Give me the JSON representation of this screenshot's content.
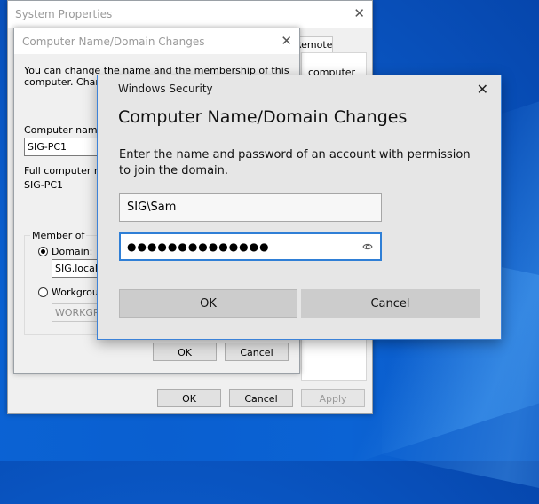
{
  "system_properties": {
    "title": "System Properties",
    "tab_remote": "Remote",
    "tab_text": "computer",
    "ok_label": "OK",
    "cancel_label": "Cancel",
    "apply_label": "Apply"
  },
  "name_dialog": {
    "title": "Computer Name/Domain Changes",
    "intro_line1": "You can change the name and the membership of this",
    "intro_line2": "computer. Changes might affect access to network resources.",
    "computer_name_label": "Computer name:",
    "computer_name_value": "SIG-PC1",
    "full_name_label": "Full computer name:",
    "full_name_value": "SIG-PC1",
    "member_of_label": "Member of",
    "domain_label": "Domain:",
    "domain_value": "SIG.local",
    "workgroup_label": "Workgroup:",
    "workgroup_value": "WORKGROUP",
    "ok_label": "OK",
    "cancel_label": "Cancel"
  },
  "windows_security": {
    "title": "Windows Security",
    "heading": "Computer Name/Domain Changes",
    "description": "Enter the name and password of an account with permission to join the domain.",
    "username_value": "SIG\\Sam",
    "password_masked": "●●●●●●●●●●●●●●",
    "ok_label": "OK",
    "cancel_label": "Cancel"
  },
  "colors": {
    "desktop_blue": "#0a5fd0",
    "focus_blue": "#2f7fd6"
  }
}
